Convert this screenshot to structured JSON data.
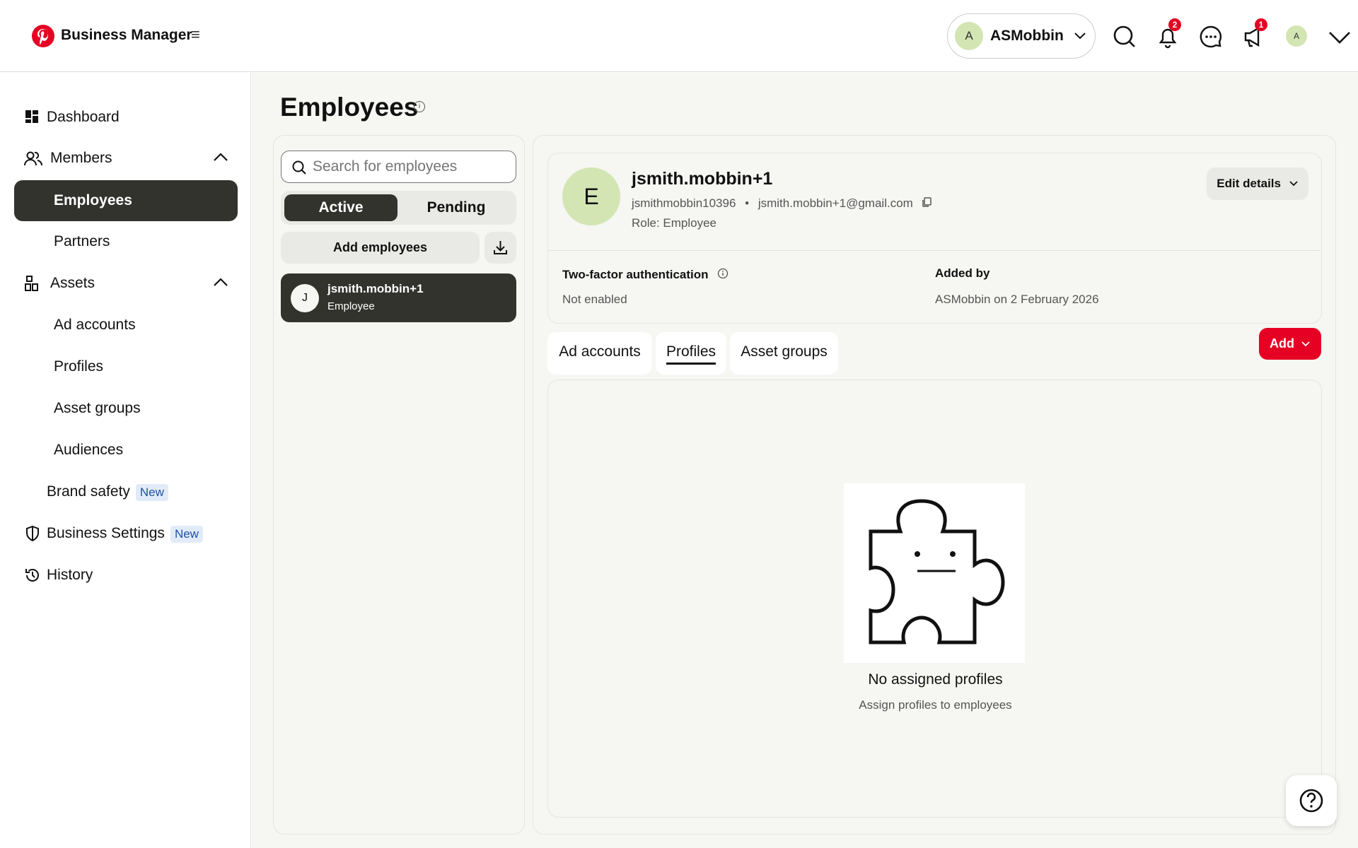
{
  "header": {
    "brand": "Business Manager",
    "menu_icon": "≡",
    "account": {
      "avatar": "A",
      "name": "ASMobbin"
    },
    "notifications_badge": "2",
    "updates_badge": "1",
    "user_avatar": "A"
  },
  "sidebar": {
    "dashboard": "Dashboard",
    "members": "Members",
    "employees": "Employees",
    "partners": "Partners",
    "assets": "Assets",
    "ad_accounts": "Ad accounts",
    "profiles": "Profiles",
    "asset_groups": "Asset groups",
    "audiences": "Audiences",
    "brand_safety": "Brand safety",
    "business_settings": "Business Settings",
    "new_badge": "New",
    "history": "History"
  },
  "page": {
    "title": "Employees",
    "info": "i"
  },
  "list": {
    "search_placeholder": "Search for employees",
    "tab_active": "Active",
    "tab_pending": "Pending",
    "add_employees": "Add employees",
    "employees": [
      {
        "avatar": "J",
        "name": "jsmith.mobbin+1",
        "role": "Employee"
      }
    ]
  },
  "detail": {
    "avatar": "E",
    "name": "jsmith.mobbin+1",
    "username": "jsmithmobbin10396",
    "separator": "•",
    "email": "jsmith.mobbin+1@gmail.com",
    "role": "Role: Employee",
    "edit_details": "Edit details",
    "two_factor_label": "Two-factor authentication",
    "two_factor_value": "Not enabled",
    "added_by_label": "Added by",
    "added_by_value": "ASMobbin on 2 February 2026",
    "tabs": [
      "Ad accounts",
      "Profiles",
      "Asset groups"
    ],
    "selected_tab": "Profiles",
    "add_button": "Add",
    "empty_title": "No assigned profiles",
    "empty_subtitle": "Assign profiles to employees"
  },
  "colors": {
    "brand": "#e60023",
    "active_dark": "#33332e",
    "avatar_green": "#d3e5b3",
    "new_badge_bg": "#e1ebf8"
  }
}
